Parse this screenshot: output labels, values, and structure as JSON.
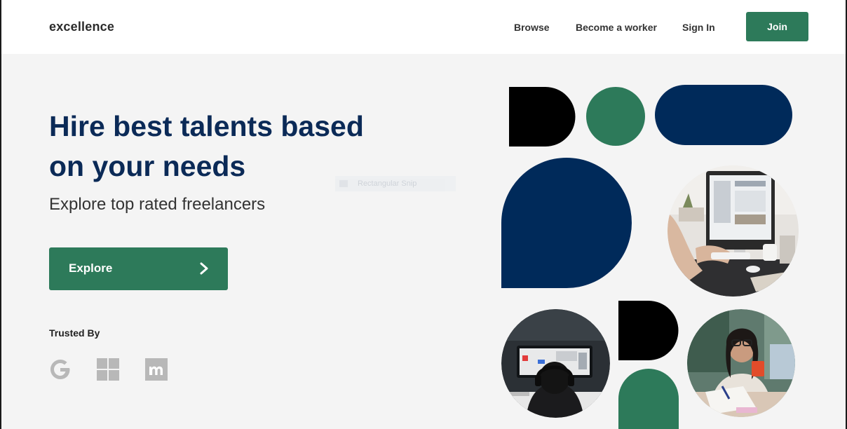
{
  "header": {
    "logo": "excellence",
    "nav": {
      "browse": "Browse",
      "become_worker": "Become a worker",
      "sign_in": "Sign In"
    },
    "join_label": "Join"
  },
  "hero": {
    "headline_line1": "Hire best talents based",
    "headline_line2": "on your needs",
    "subheadline": "Explore top rated freelancers",
    "explore_label": "Explore",
    "ghost_label": "Rectangular Snip"
  },
  "trusted": {
    "title": "Trusted By",
    "logos": [
      "google-icon",
      "microsoft-icon",
      "meetup-icon"
    ]
  },
  "colors": {
    "accent_green": "#2d7a5a",
    "navy": "#0b2a57",
    "shape_navy": "#002a5a",
    "background": "#f4f4f4"
  }
}
